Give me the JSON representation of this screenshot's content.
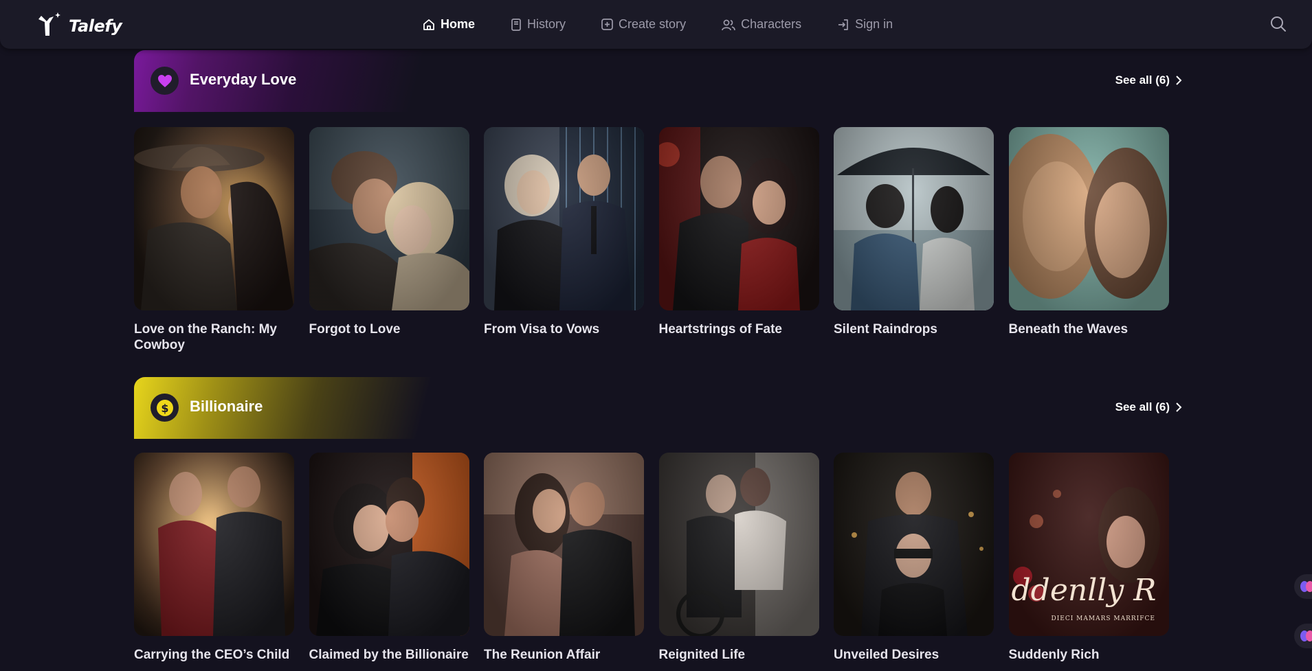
{
  "brand": {
    "name": "Talefy"
  },
  "nav": {
    "items": [
      {
        "label": "Home",
        "icon": "home-icon",
        "active": true
      },
      {
        "label": "History",
        "icon": "book-icon",
        "active": false
      },
      {
        "label": "Create story",
        "icon": "plus-square-icon",
        "active": false
      },
      {
        "label": "Characters",
        "icon": "users-icon",
        "active": false
      },
      {
        "label": "Sign in",
        "icon": "sign-in-icon",
        "active": false
      }
    ],
    "search_icon": "search-icon"
  },
  "sections": [
    {
      "title": "Everyday Love",
      "icon": "heart-icon",
      "accent": "#c23df5",
      "see_all": "See all (6)",
      "stories": [
        {
          "title": "Love on the Ranch: My Cowboy",
          "palette": [
            "#3b2c22",
            "#b27a3c",
            "#6a4a2c"
          ]
        },
        {
          "title": "Forgot to Love",
          "palette": [
            "#2b3640",
            "#8d7a66",
            "#d4c1a6"
          ]
        },
        {
          "title": "From Visa to Vows",
          "palette": [
            "#2a2f40",
            "#c9b9a8",
            "#141822"
          ]
        },
        {
          "title": "Heartstrings of Fate",
          "palette": [
            "#3a0f10",
            "#8f1c1c",
            "#1b1212"
          ]
        },
        {
          "title": "Silent Raindrops",
          "palette": [
            "#c7d1d3",
            "#5a6a72",
            "#23303a"
          ]
        },
        {
          "title": "Beneath the Waves",
          "palette": [
            "#8fb8ae",
            "#c89a72",
            "#6a4a36"
          ]
        }
      ]
    },
    {
      "title": "Billionaire",
      "icon": "dollar-coin-icon",
      "accent": "#f0d91a",
      "see_all": "See all (6)",
      "stories": [
        {
          "title": "Carrying the CEO’s Child",
          "palette": [
            "#e0a655",
            "#7b1d1e",
            "#241a1a"
          ]
        },
        {
          "title": "Claimed by the Billionaire",
          "palette": [
            "#d9641e",
            "#2a1612",
            "#0f0f12"
          ]
        },
        {
          "title": "The Reunion Affair",
          "palette": [
            "#8d6654",
            "#3b2622",
            "#191414"
          ]
        },
        {
          "title": "Reignited Life",
          "palette": [
            "#6e6a66",
            "#2a2624",
            "#cfc9c2"
          ]
        },
        {
          "title": "Unveiled Desires",
          "palette": [
            "#3b3128",
            "#17130f",
            "#8a6e4a"
          ]
        },
        {
          "title": "Suddenly Rich",
          "palette": [
            "#5a1e1c",
            "#c97a6a",
            "#2a1414"
          ],
          "cover_text": "ddenlly R",
          "cover_subtext": "DIECI MAMARS MARRIFCE"
        }
      ]
    }
  ]
}
